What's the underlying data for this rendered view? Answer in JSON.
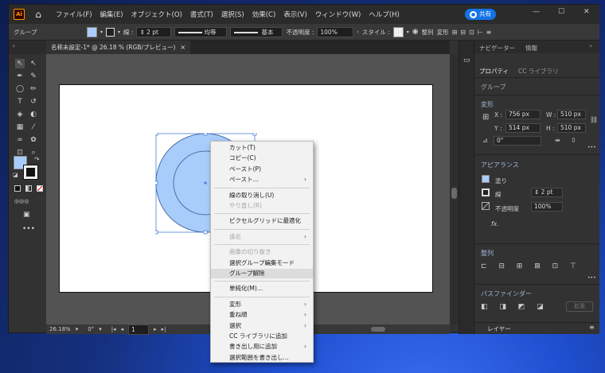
{
  "app": {
    "logo": "Ai",
    "window_controls": [
      "—",
      "☐",
      "✕"
    ]
  },
  "menu": [
    "ファイル(F)",
    "編集(E)",
    "オブジェクト(O)",
    "書式(T)",
    "選択(S)",
    "効果(C)",
    "表示(V)",
    "ウィンドウ(W)",
    "ヘルプ(H)"
  ],
  "share_button": "共有",
  "control_bar": {
    "selection_label": "グループ",
    "stroke_label": "線 :",
    "stroke_weight": "2 pt",
    "stroke_profile": "均等",
    "brush": "基本",
    "opacity_label": "不透明度 :",
    "opacity_value": "100%",
    "style_label": "スタイル :",
    "align_label": "整列",
    "transform_label": "変形"
  },
  "document_tab": {
    "title": "名称未設定-1* @ 26.18 % (RGB/プレビュー)",
    "close": "×"
  },
  "status_bar": {
    "zoom": "26.18%",
    "rotation": "0°",
    "artboard": "1"
  },
  "context_menu": [
    {
      "label": "カット(T)",
      "enabled": true
    },
    {
      "label": "コピー(C)",
      "enabled": true
    },
    {
      "label": "ペースト(P)",
      "enabled": true
    },
    {
      "label": "ペースト...",
      "enabled": true,
      "submenu": true
    },
    {
      "separator": true
    },
    {
      "label": "線の取り消し(U)",
      "enabled": true
    },
    {
      "label": "やり直し(R)",
      "enabled": false
    },
    {
      "separator": true
    },
    {
      "label": "ピクセルグリッドに最適化",
      "enabled": true
    },
    {
      "separator": true
    },
    {
      "label": "遠近",
      "enabled": false,
      "submenu": true
    },
    {
      "separator": true
    },
    {
      "label": "画像の切り抜き",
      "enabled": false
    },
    {
      "label": "選択グループ編集モード",
      "enabled": true
    },
    {
      "label": "グループ解除",
      "enabled": true,
      "highlighted": true
    },
    {
      "separator": true
    },
    {
      "label": "単純化(M)...",
      "enabled": true
    },
    {
      "separator": true
    },
    {
      "label": "変形",
      "enabled": true,
      "submenu": true
    },
    {
      "label": "重ね順",
      "enabled": true,
      "submenu": true
    },
    {
      "label": "選択",
      "enabled": true,
      "submenu": true
    },
    {
      "label": "CC ライブラリに追加",
      "enabled": true
    },
    {
      "label": "書き出し用に追加",
      "enabled": true,
      "submenu": true
    },
    {
      "label": "選択範囲を書き出し...",
      "enabled": true
    }
  ],
  "panel": {
    "tabs": [
      "ナビゲーター",
      "情報"
    ],
    "subtabs": [
      "プロパティ",
      "CC ライブラリ"
    ],
    "selection_type": "グループ",
    "transform": {
      "title": "変形",
      "x_label": "X :",
      "x": "756 px",
      "y_label": "Y :",
      "y": "514 px",
      "w_label": "W :",
      "w": "510 px",
      "h_label": "H :",
      "h": "510 px",
      "angle": "0°"
    },
    "appearance": {
      "title": "アピアランス",
      "fill_label": "塗り",
      "stroke_label": "線",
      "stroke_weight": "2 pt",
      "opacity_label": "不透明度",
      "opacity": "100%",
      "fx": "fx."
    },
    "align": {
      "title": "整列"
    },
    "pathfinder": {
      "title": "パスファインダー",
      "expand": "拡張"
    },
    "layers_tab": "レイヤー"
  },
  "colors": {
    "fill": "#a9cdfb",
    "stroke": "#4a6fa8",
    "accent": "#1473e6",
    "selection": "#4a7fd6"
  }
}
